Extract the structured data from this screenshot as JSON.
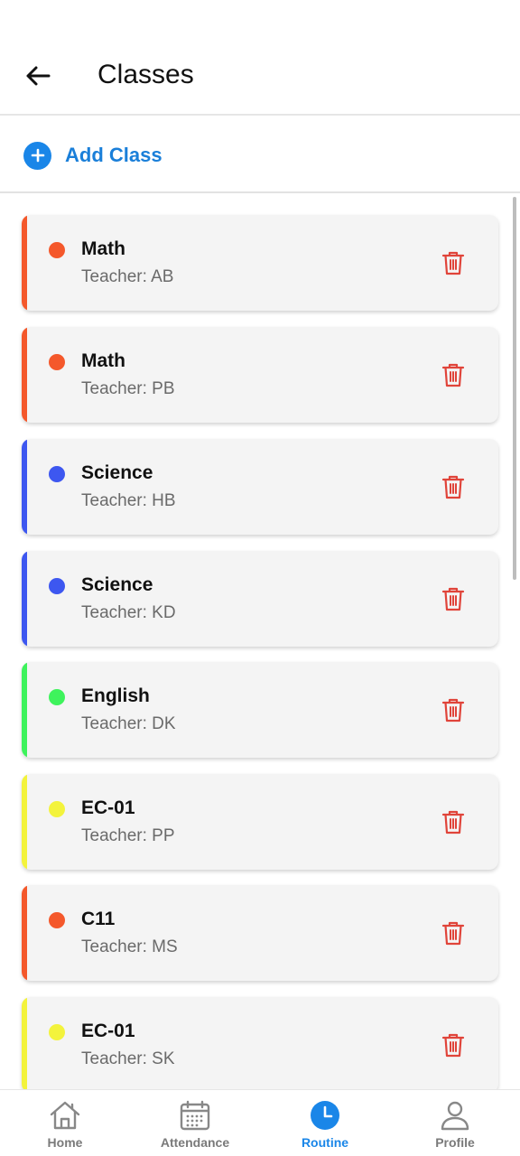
{
  "header": {
    "title": "Classes",
    "back_icon": "arrow-left-icon"
  },
  "actions": {
    "add_class_label": "Add Class",
    "add_icon": "plus-circle-icon",
    "accent": "#1a86e8"
  },
  "classes": [
    {
      "name": "Math",
      "teacher": "Teacher: AB",
      "color": "#f4582b"
    },
    {
      "name": "Math",
      "teacher": "Teacher: PB",
      "color": "#f4582b"
    },
    {
      "name": "Science",
      "teacher": "Teacher: HB",
      "color": "#3d57f0"
    },
    {
      "name": "Science",
      "teacher": "Teacher: KD",
      "color": "#3d57f0"
    },
    {
      "name": "English",
      "teacher": "Teacher: DK",
      "color": "#3ef35c"
    },
    {
      "name": "EC-01",
      "teacher": "Teacher: PP",
      "color": "#f3f33c"
    },
    {
      "name": "C11",
      "teacher": "Teacher: MS",
      "color": "#f4582b"
    },
    {
      "name": "EC-01",
      "teacher": "Teacher: SK",
      "color": "#f3f33c"
    }
  ],
  "delete_icon": "trash-icon",
  "delete_color": "#e0443a",
  "nav": {
    "items": [
      {
        "label": "Home",
        "icon": "home-icon"
      },
      {
        "label": "Attendance",
        "icon": "calendar-icon"
      },
      {
        "label": "Routine",
        "icon": "clock-icon"
      },
      {
        "label": "Profile",
        "icon": "user-icon"
      }
    ],
    "active": "Routine",
    "active_color": "#1a86e8"
  }
}
